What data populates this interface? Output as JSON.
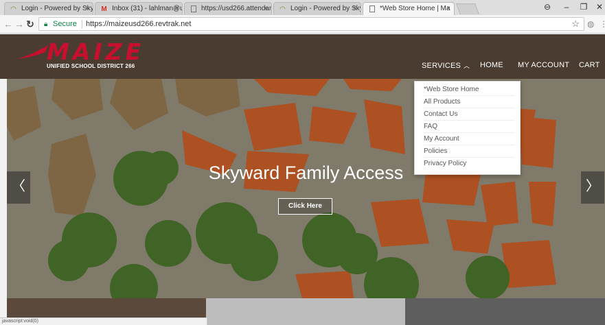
{
  "browser": {
    "tabs": [
      {
        "title": "Login - Powered by Sky",
        "icon": "skyward-icon"
      },
      {
        "title": "Inbox (31) - lahlman@u",
        "icon": "gmail-icon"
      },
      {
        "title": "https://usd266.attendan",
        "icon": "page-icon"
      },
      {
        "title": "Login - Powered by Sky",
        "icon": "skyward-icon"
      },
      {
        "title": "*Web Store Home | Ma",
        "icon": "page-icon"
      }
    ],
    "close_glyph": "×",
    "security_label": "Secure",
    "url": "https://maizeusd266.revtrak.net",
    "status_text": "javascript:void(0)"
  },
  "site": {
    "logo_text": "MAIZE",
    "logo_subtitle": "UNIFIED SCHOOL DISTRICT 266",
    "nav": {
      "services": "SERVICES",
      "home": "HOME",
      "account": "MY ACCOUNT",
      "cart": "CART"
    },
    "dropdown_items": [
      "*Web Store Home",
      "All Products",
      "Contact Us",
      "FAQ",
      "My Account",
      "Policies",
      "Privacy Policy"
    ],
    "hero": {
      "title": "Skyward Family Access",
      "button_label": "Click Here",
      "prev_glyph": "〈",
      "next_glyph": "〉"
    }
  },
  "colors": {
    "header_bg": "#4a3c30",
    "brand_red": "#c8102e",
    "strip_dark": "#5b4a3c",
    "strip_mid": "#bdbdbd",
    "strip_gray": "#5e5e5e"
  }
}
